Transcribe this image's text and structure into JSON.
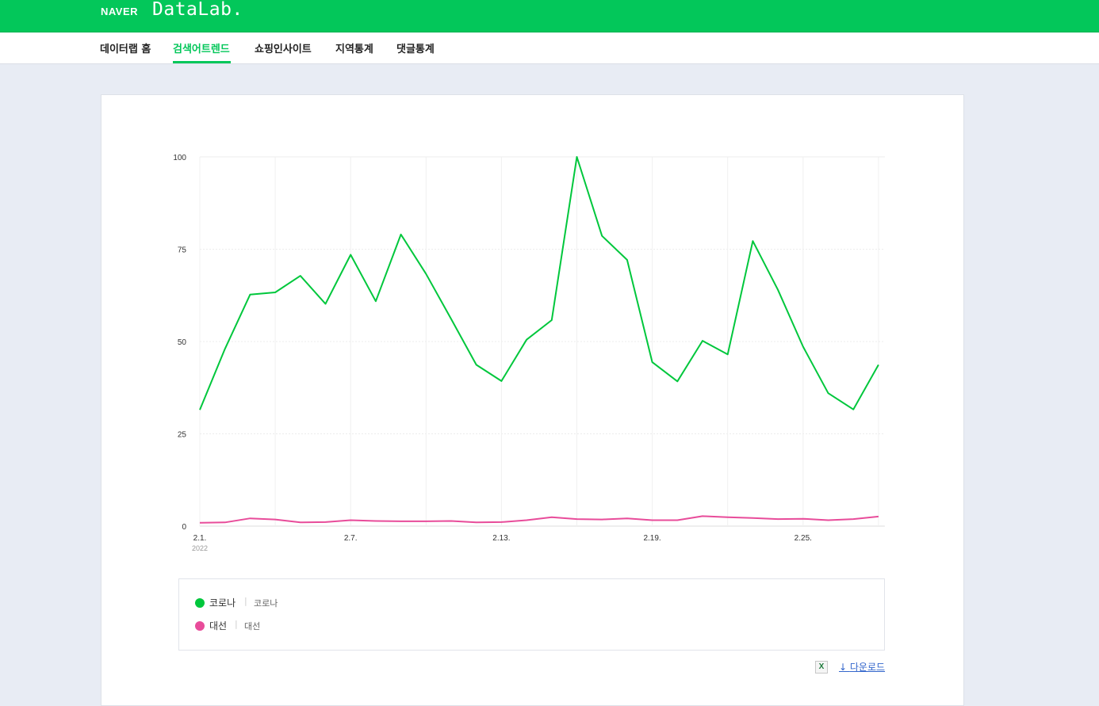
{
  "header": {
    "brand": "NAVER",
    "product": "DataLab.",
    "bg_color": "#03c75a"
  },
  "nav": {
    "items": [
      {
        "label": "데이터랩 홈"
      },
      {
        "label": "검색어트렌드",
        "active": true
      },
      {
        "label": "쇼핑인사이트"
      },
      {
        "label": "지역통계"
      },
      {
        "label": "댓글통계"
      }
    ]
  },
  "chart_data": {
    "type": "line",
    "x": [
      "2.1.",
      "2.2.",
      "2.3.",
      "2.4.",
      "2.5.",
      "2.6.",
      "2.7.",
      "2.8.",
      "2.9.",
      "2.10.",
      "2.11.",
      "2.12.",
      "2.13.",
      "2.14.",
      "2.15.",
      "2.16.",
      "2.17.",
      "2.18.",
      "2.19.",
      "2.20.",
      "2.21.",
      "2.22.",
      "2.23.",
      "2.24.",
      "2.25.",
      "2.26.",
      "2.27.",
      "2.28."
    ],
    "x_tick_labels": [
      "2.1.",
      "2.7.",
      "2.13.",
      "2.19.",
      "2.25."
    ],
    "x_sub_label": "2022",
    "y_ticks": [
      "100",
      "75",
      "50",
      "25",
      "0"
    ],
    "ylim": [
      0,
      100
    ],
    "grid": true,
    "series": [
      {
        "name": "코로나",
        "color": "#00c73c",
        "values": [
          31.5,
          48,
          62.7,
          63.3,
          67.8,
          60.2,
          73.5,
          60.9,
          79,
          68.3,
          56.1,
          43.7,
          39.3,
          50.5,
          55.8,
          100,
          78.6,
          72.1,
          44.4,
          39.2,
          50.2,
          46.5,
          77.2,
          64,
          48.6,
          36,
          31.6,
          43.7
        ]
      },
      {
        "name": "대선",
        "color": "#e84c9a",
        "values": [
          0.9,
          1,
          2.1,
          1.8,
          1,
          1.1,
          1.6,
          1.4,
          1.3,
          1.3,
          1.4,
          1,
          1.1,
          1.6,
          2.4,
          1.9,
          1.8,
          2.1,
          1.6,
          1.6,
          2.7,
          2.4,
          2.2,
          1.9,
          2,
          1.6,
          1.9,
          2.6
        ]
      }
    ]
  },
  "legend": {
    "items": [
      {
        "name": "코로나",
        "keywords": "코로나",
        "color": "#00c73c"
      },
      {
        "name": "대선",
        "keywords": "대선",
        "color": "#e84c9a"
      }
    ]
  },
  "download": {
    "excel_icon": "excel-icon",
    "label": "다운로드"
  }
}
